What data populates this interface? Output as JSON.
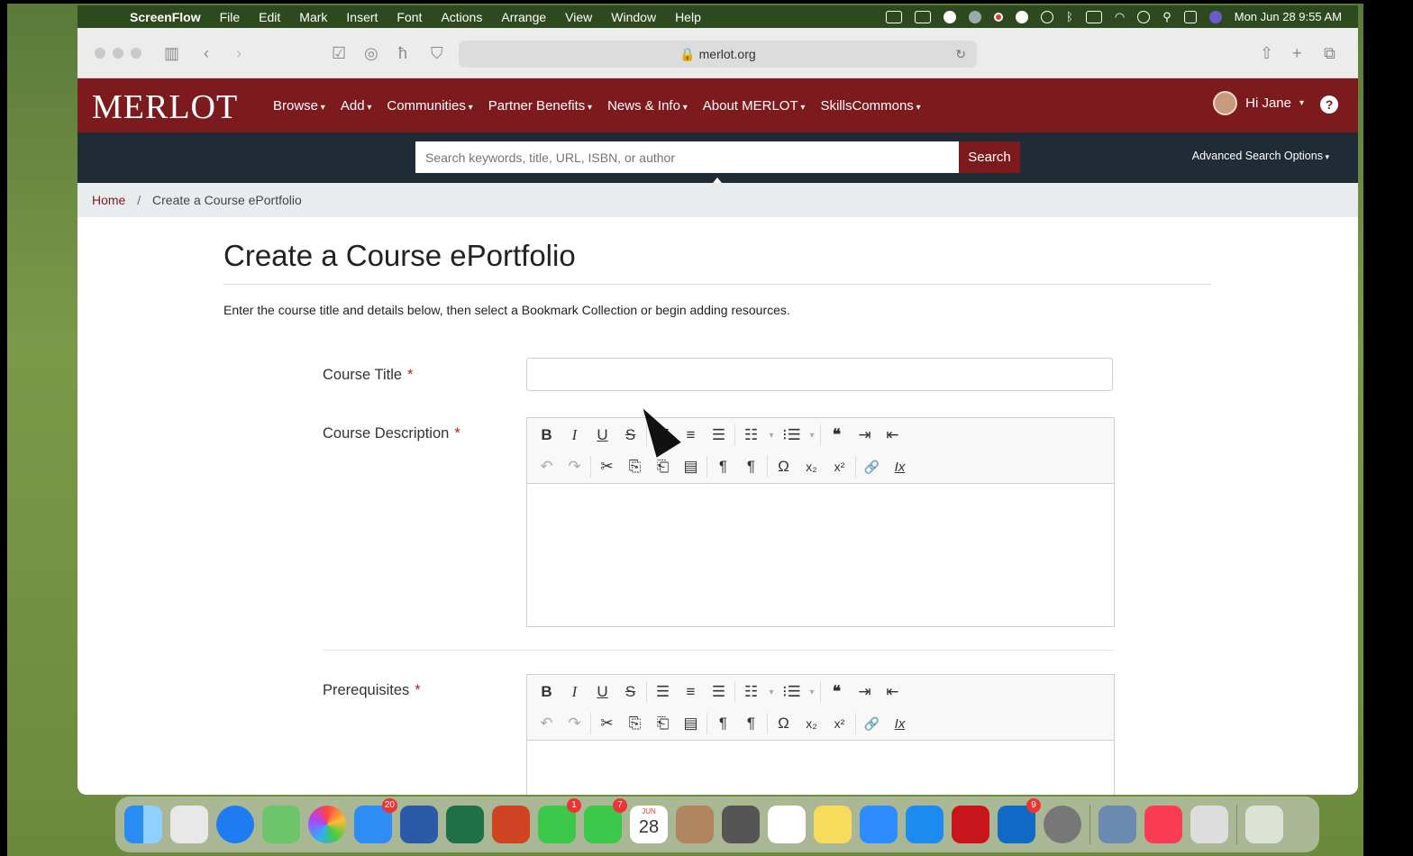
{
  "menubar": {
    "app_name": "ScreenFlow",
    "items": [
      "File",
      "Edit",
      "Mark",
      "Insert",
      "Font",
      "Actions",
      "Arrange",
      "View",
      "Window",
      "Help"
    ],
    "clock": "Mon Jun 28  9:55 AM"
  },
  "browser": {
    "url": "merlot.org"
  },
  "site": {
    "logo": "MERLOT",
    "nav": [
      "Browse",
      "Add",
      "Communities",
      "Partner Benefits",
      "News & Info",
      "About MERLOT",
      "SkillsCommons"
    ],
    "user_greeting": "Hi Jane",
    "help": "?"
  },
  "search": {
    "placeholder": "Search keywords, title, URL, ISBN, or author",
    "button": "Search",
    "advanced": "Advanced Search Options"
  },
  "breadcrumb": {
    "home": "Home",
    "sep": "/",
    "current": "Create a Course ePortfolio"
  },
  "page": {
    "title": "Create a Course ePortfolio",
    "intro": "Enter the course title and details below, then select a Bookmark Collection or begin adding resources."
  },
  "form": {
    "required_mark": "*",
    "course_title_label": "Course Title",
    "course_description_label": "Course Description",
    "prerequisites_label": "Prerequisites"
  },
  "editor_tools": {
    "bold": "B",
    "italic": "I",
    "underline": "U",
    "strike": "S",
    "align_left": "☰",
    "align_center": "≡",
    "align_right": "☰",
    "bullets": "☷",
    "numbered": "⁝☰",
    "quote": "❝",
    "indent": "⇥",
    "outdent": "⇤",
    "undo": "↶",
    "redo": "↷",
    "cut": "✂",
    "copy": "⎘",
    "paste": "⎗",
    "paste_text": "▤",
    "ltr": "¶",
    "rtl": "¶",
    "omega": "Ω",
    "subscript": "x₂",
    "superscript": "x²",
    "link": "🔗",
    "clear": "Ix"
  },
  "dock": {
    "mail_badge": "20",
    "messages_badge": "1",
    "facetime_badge": "7",
    "calendar_month": "JUN",
    "calendar_day": "28",
    "outlook_badge": "9"
  }
}
